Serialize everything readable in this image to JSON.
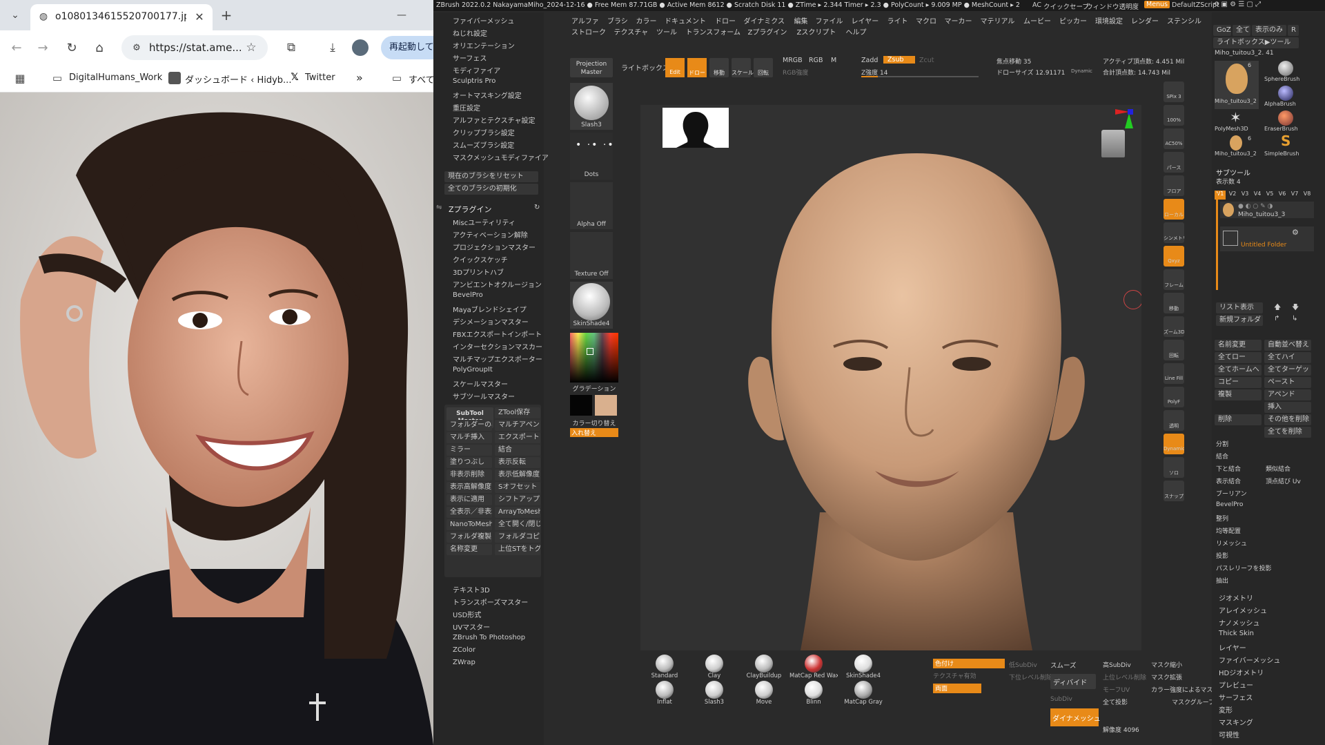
{
  "browser": {
    "tab_title": "o1080134615520700177.jpg (10",
    "url": "https://stat.ame...",
    "restart_label": "再起動して更",
    "bookmarks": [
      "DigitalHumans_Work",
      "ダッシュボード ‹ Hidyb...",
      "Twitter",
      "»",
      "すべて"
    ]
  },
  "zbrush": {
    "title_bar": "ZBrush 2022.0.2   NakayamaMiho_2024-12-16   ● Free Mem 87.71GB ● Active Mem 8612 ● Scratch Disk 11 ● ZTime ▸ 2.344 Timer ▸ 2.3 ● PolyCount ▸ 9.009 MP ● MeshCount ▸ 2",
    "title_right": {
      "ac": "AC",
      "quicksave": "クイックセーブ",
      "transparency": "ウィンドウ透明度",
      "menus": "Menus",
      "script": "DefaultZScript"
    },
    "menu_row1": [
      "アルファ",
      "ブラシ",
      "カラー",
      "ドキュメント",
      "ドロー",
      "ダイナミクス",
      "編集",
      "ファイル",
      "レイヤー",
      "ライト",
      "マクロ",
      "マーカー",
      "マテリアル",
      "ムービー",
      "ピッカー",
      "環境設定",
      "レンダー",
      "ステンシル"
    ],
    "menu_row2": [
      "ストローク",
      "テクスチャ",
      "ツール",
      "トランスフォーム",
      "Zプラグイン",
      "Zスクリプト",
      "ヘルプ"
    ],
    "left_top_items": [
      "ファイバーメッシュ",
      "ねじれ設定",
      "オリエンテーション",
      "サーフェス",
      "モディファイア",
      "Sculptris Pro",
      "オートマスキング設定",
      "重圧設定",
      "アルファとテクスチャ設定",
      "クリップブラシ設定",
      "スムーズブラシ設定",
      "マスクメッシュモディファイア"
    ],
    "left_reset_buttons": [
      "現在のブラシをリセット",
      "全てのブラシの初期化"
    ],
    "zplugin_header": "Zプラグイン",
    "zplugin_items": [
      "Miscユーティリティ",
      "アクティベーション解除",
      "プロジェクションマスター",
      "クイックスケッチ",
      "3Dプリントハブ",
      "アンビエントオクルージョン",
      "BevelPro",
      "Mayaブレンドシェイプ",
      "デシメーションマスター",
      "FBXエクスポートインポート",
      "インターセクションマスカー",
      "マルチマップエクスポーター",
      "PolyGroupIt",
      "スケールマスター",
      "サブツールマスター"
    ],
    "subtool_master": {
      "title": "SubTool Master",
      "buttons": [
        "ZTool保存",
        "フォルダーのみ",
        "マルチアペンド",
        "マルチ挿入",
        "エクスポート",
        "ミラー",
        "結合",
        "塗りつぶし",
        "表示反転",
        "非表示削除",
        "表示低解像度",
        "表示高解像度",
        "Sオフセット",
        "表示に適用",
        "シフトアップ",
        "全表示／非表示",
        "ArrayToMesh",
        "NanoToMesh",
        "全て開く/閉じる",
        "フォルダ複製",
        "フォルダコピー",
        "名称変更",
        "上位STをトグル"
      ]
    },
    "left_bottom_items": [
      "テキスト3D",
      "トランスポーズマスター",
      "USD形式",
      "UVマスター",
      "ZBrush To Photoshop",
      "ZColor",
      "ZWrap"
    ],
    "shelf": {
      "projection_master": "Projection Master",
      "lightbox": "ライトボックス",
      "brush": "Slash3",
      "stroke": "Dots",
      "alpha": "Alpha Off",
      "texture": "Texture Off",
      "material": "SkinShade4",
      "gradient": "グラデーション",
      "color_switch": "カラー切り替え",
      "swap": "入れ替え"
    },
    "top_controls": {
      "edit": "Edit",
      "draw": "ドロー",
      "move": "移動",
      "scale": "スケール",
      "rotate": "回転",
      "mrgb": "MRGB",
      "rgb": "RGB",
      "m": "M",
      "rgb_intensity": "RGB強度",
      "zadd": "Zadd",
      "zsub": "Zsub",
      "zcut": "Zcut",
      "z_intensity": "Z強度 14",
      "focal_shift": "焦点移動 35",
      "draw_size": "ドローサイズ 12.91171",
      "dynamic": "Dynamic",
      "active_points": "アクティブ頂点数: 4.451 Mil",
      "total_points": "合計頂点数: 14.743 Mil"
    },
    "right_strip": [
      "SPix 3",
      "100%",
      "AC50%",
      "パース",
      "フロア",
      "ローカル",
      "シンメトリー",
      "Qxyz",
      "フレーム",
      "移動",
      "ズーム3D",
      "回転",
      "Line Fill",
      "PolyF",
      "透明",
      "Dynamic",
      "ソロ",
      "スナップ"
    ],
    "brush_palette": [
      "Standard",
      "Clay",
      "ClayBuildup",
      "MatCap Red Wax",
      "SkinShade4",
      "Inflat",
      "Slash3",
      "Move",
      "Blinn",
      "MatCap Gray"
    ],
    "bottom_controls": {
      "colorize": "色付け",
      "lower_subdiv": "低SubDiv",
      "higher_subdiv": "高SubDiv",
      "smooth": "スムーズ",
      "divide": "ディバイド",
      "dynamesh": "ダイナメッシュ",
      "resolution": "解像度 4096",
      "texture_on": "テクスチャ有効",
      "double": "両面",
      "lower_res_delete": "下位レベル削除",
      "higher_res_delete": "上位レベル削除",
      "morph_uv": "モーフUV",
      "project_all": "全て投影",
      "mask_shrink": "マスク縮小",
      "mask_grow": "マスク拡張",
      "mask_by_color": "カラー強度によるマスク",
      "mask_group": "マスクグループ",
      "subdiv": "SubDiv",
      "auto": "自動",
      "display": "表示"
    },
    "right_panel": {
      "top_buttons": [
        "GoZ",
        "全て",
        "表示のみ",
        "R"
      ],
      "lightbox_tool": "ライトボックス▶ツール",
      "tool_name": "Miho_tuitou3_2. 41",
      "tools": [
        {
          "name": "Miho_tuitou3_2",
          "count": "6"
        },
        {
          "name": "SphereBrush",
          "count": ""
        },
        {
          "name": "AlphaBrush",
          "count": ""
        },
        {
          "name": "PolyMesh3D",
          "count": ""
        },
        {
          "name": "EraserBrush",
          "count": ""
        },
        {
          "name": "Miho_tuitou3_2",
          "count": "6"
        },
        {
          "name": "SimpleBrush",
          "count": ""
        }
      ],
      "subtool_header": "サブツール",
      "visible_count": "表示数 4",
      "versions": [
        "V1",
        "V2",
        "V3",
        "V4",
        "V5",
        "V6",
        "V7",
        "V8"
      ],
      "subtool_name": "Miho_tuitou3_3",
      "folder_name": "Untitled Folder",
      "list_buttons": [
        "リスト表示",
        "新規フォルダ"
      ],
      "actions": [
        [
          "名前変更",
          "自動並べ替え"
        ],
        [
          "全てロー",
          "全てハイ"
        ],
        [
          "全てホームへ",
          "全てターゲット"
        ],
        [
          "コピー",
          "ペースト"
        ],
        [
          "複製",
          "アペンド"
        ],
        [
          "",
          "挿入"
        ],
        [
          "削除",
          "その他を削除"
        ],
        [
          "",
          "全てを削除"
        ]
      ],
      "menu_items": [
        "分割",
        "結合",
        "下と結合",
        "類似結合",
        "表示結合",
        "頂点結び Uv",
        "ブーリアン",
        "BevelPro",
        "整列",
        "均等配置",
        "リメッシュ",
        "投影",
        "パスレリーフを投影",
        "抽出"
      ],
      "bottom_items": [
        "ジオメトリ",
        "アレイメッシュ",
        "ナノメッシュ",
        "Thick Skin",
        "レイヤー",
        "ファイバーメッシュ",
        "HDジオメトリ",
        "プレビュー",
        "サーフェス",
        "変形",
        "マスキング",
        "可視性"
      ]
    }
  }
}
